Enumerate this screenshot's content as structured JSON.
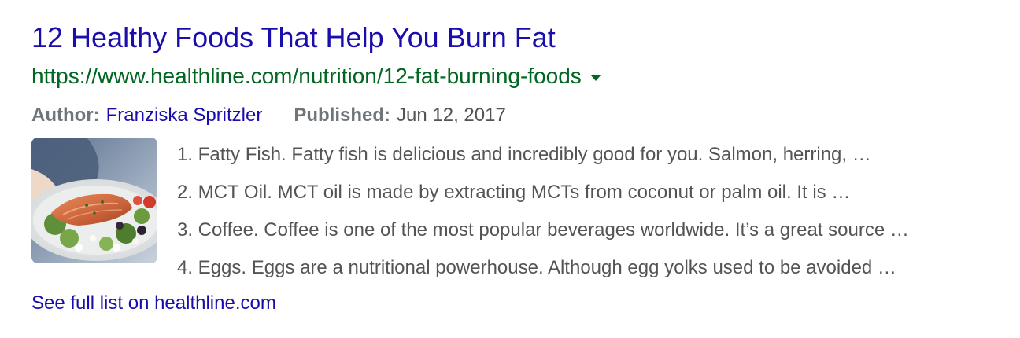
{
  "result": {
    "title": "12 Healthy Foods That Help You Burn Fat",
    "url": "https://www.healthline.com/nutrition/12-fat-burning-foods",
    "author_label": "Author:",
    "author": "Franziska Spritzler",
    "published_label": "Published:",
    "published": "Jun 12, 2017",
    "list": [
      "1. Fatty Fish. Fatty fish is delicious and incredibly good for you. Salmon, herring, …",
      "2. MCT Oil. MCT oil is made by extracting MCTs from coconut or palm oil. It is …",
      "3. Coffee. Coffee is one of the most popular beverages worldwide. It’s a great source …",
      "4. Eggs. Eggs are a nutritional powerhouse. Although egg yolks used to be avoided …"
    ],
    "more_link": "See full list on healthline.com",
    "thumbnail_icon": "salmon-salad-image",
    "url_menu_icon": "caret-down-icon"
  },
  "colors": {
    "title": "#1a0dab",
    "url": "#006621",
    "snippet": "#545454",
    "meta_label": "#70757a"
  }
}
